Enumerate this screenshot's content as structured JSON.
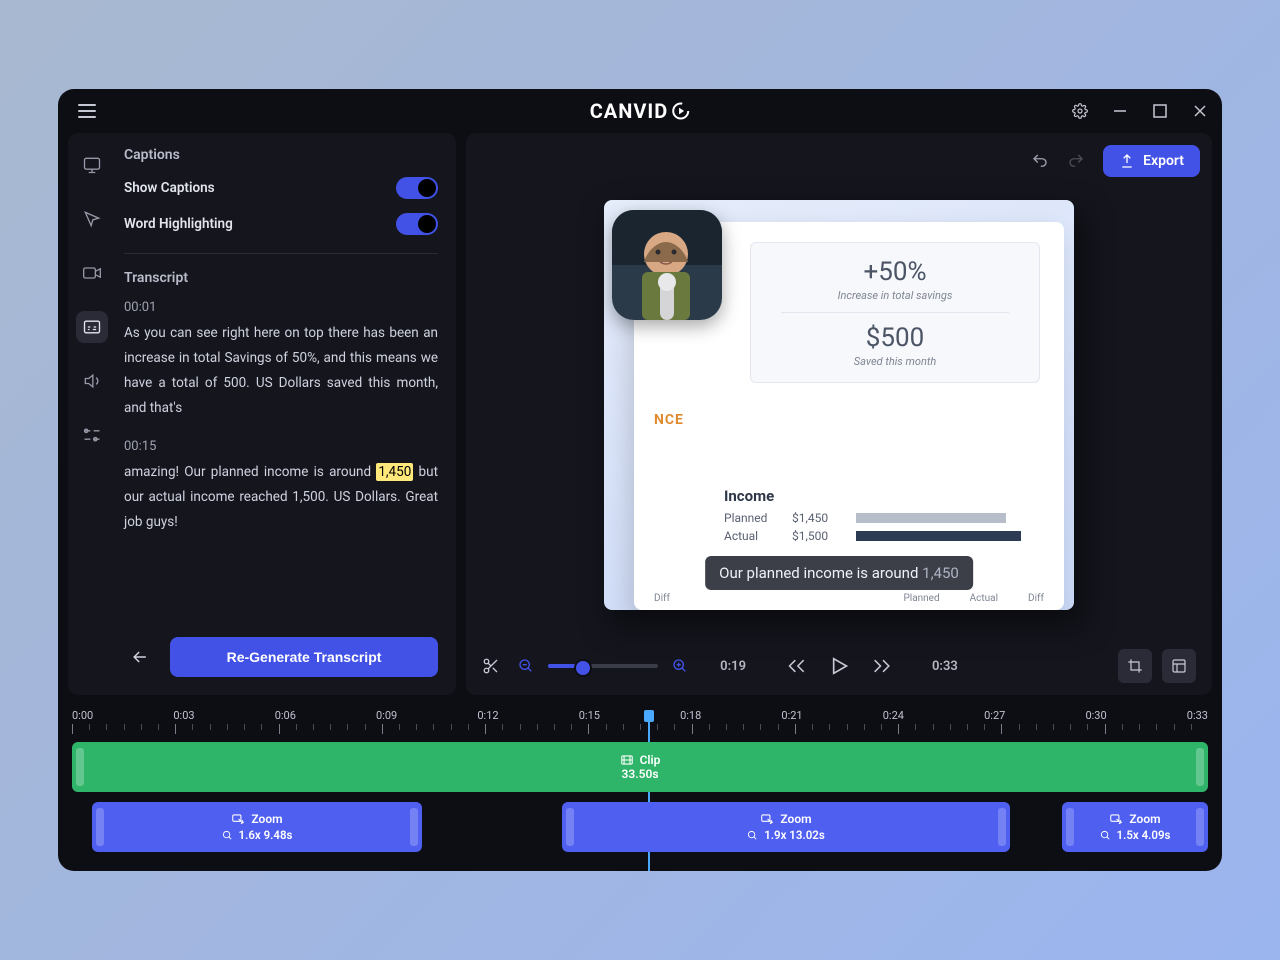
{
  "app": {
    "name": "CANVID"
  },
  "titlebar": {
    "settings": "settings",
    "min": "minimize",
    "max": "maximize",
    "close": "close"
  },
  "left": {
    "captions_title": "Captions",
    "show_captions": "Show Captions",
    "word_highlight": "Word Highlighting",
    "transcript_title": "Transcript",
    "seg1_time": "00:01",
    "seg1_text_a": "As you can see right here on top  there has been an increase in total Savings of 50%, and this means we have a total of 500. US Dollars saved this month, and that's",
    "seg2_time": "00:15",
    "seg2_a": "amazing! Our planned income is around ",
    "seg2_hl": "1,450",
    "seg2_b": " but our actual income reached 1,500. US Dollars. Great job guys!",
    "regen": "Re-Generate Transcript"
  },
  "preview": {
    "export": "Export",
    "stat1": "+50%",
    "stat1_sub": "Increase in total savings",
    "stat2": "$500",
    "stat2_sub": "Saved this month",
    "nce": "NCE",
    "income_title": "Income",
    "planned_lbl": "Planned",
    "planned_val": "$1,450",
    "actual_lbl": "Actual",
    "actual_val": "$1,500",
    "mini_diff1": "Diff",
    "mini_planned": "Planned",
    "mini_actual": "Actual",
    "mini_diff2": "Diff",
    "caption_a": "Our planned income is around ",
    "caption_num": "1,450"
  },
  "toolbar": {
    "time_cur": "0:19",
    "time_total": "0:33"
  },
  "timeline": {
    "labels": [
      "0:00",
      "0:03",
      "0:06",
      "0:09",
      "0:12",
      "0:15",
      "0:18",
      "0:21",
      "0:24",
      "0:27",
      "0:30",
      "0:33"
    ],
    "clip_label": "Clip",
    "clip_dur": "33.50s",
    "zoom_label": "Zoom",
    "zoom1": "1.6x  9.48s",
    "zoom2": "1.9x  13.02s",
    "zoom3": "1.5x  4.09s"
  }
}
